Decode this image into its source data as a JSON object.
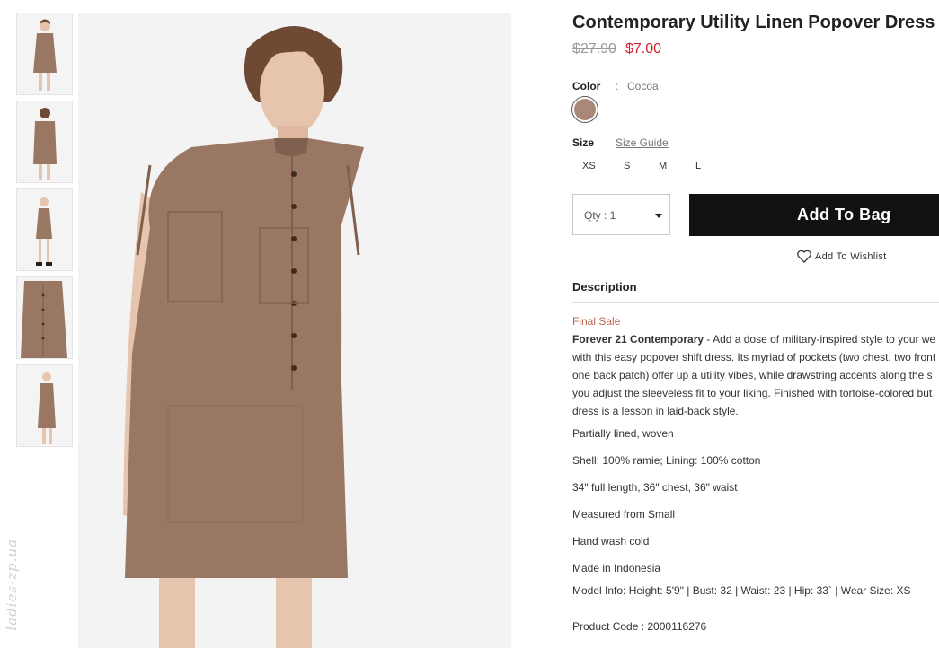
{
  "product": {
    "title": "Contemporary Utility Linen Popover Dress",
    "price_original": "$27.90",
    "price_sale": "$7.00"
  },
  "color": {
    "label": "Color",
    "separator": ":",
    "value": "Cocoa",
    "swatch_hex": "#a98877"
  },
  "size": {
    "label": "Size",
    "guide_label": "Size Guide",
    "options": [
      "XS",
      "S",
      "M",
      "L"
    ]
  },
  "qty": {
    "label": "Qty : 1"
  },
  "actions": {
    "add_to_bag": "Add To Bag",
    "wishlist": "Add To Wishlist"
  },
  "description": {
    "heading": "Description",
    "final_sale": "Final Sale",
    "brand": "Forever 21 Contemporary",
    "lines": [
      " - Add a dose of military-inspired style to your we",
      "with this easy popover shift dress. Its myriad of pockets (two chest, two front",
      "one back patch) offer up a utility vibes, while drawstring accents along the s",
      "you adjust the sleeveless fit to your liking. Finished with tortoise-colored but",
      "dress is a lesson in laid-back style."
    ],
    "bullets": [
      "Partially lined, woven",
      "Shell: 100% ramie; Lining: 100% cotton",
      "34\" full length, 36\" chest, 36\" waist",
      "Measured from Small",
      "Hand wash cold",
      "Made in Indonesia",
      "Model Info: Height: 5'9\" | Bust: 32 | Waist: 23 | Hip: 33` | Wear Size: XS"
    ],
    "product_code": "Product Code : 2000116276"
  },
  "watermark": "ladies-zp.ua",
  "colors": {
    "dress": "#9a7763",
    "dress_dark": "#7f604f",
    "skin": "#e7c4ad",
    "hair": "#6e4a35",
    "sale_red": "#d0202e"
  }
}
